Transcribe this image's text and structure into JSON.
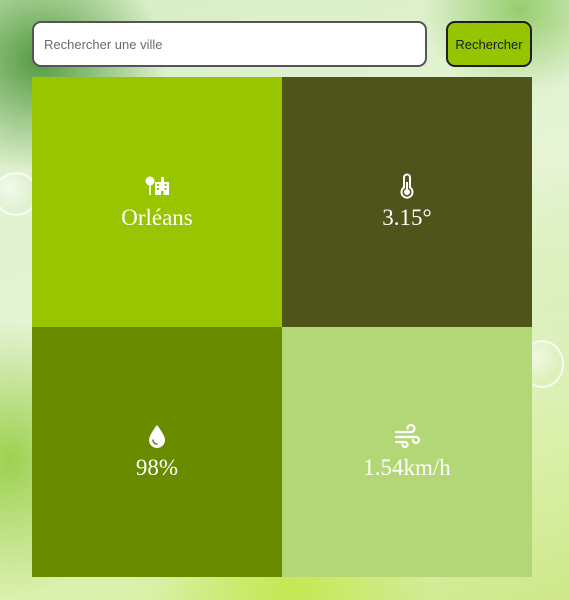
{
  "search": {
    "placeholder": "Rechercher une ville",
    "value": "",
    "button_label": "Rechercher"
  },
  "weather": {
    "city": {
      "icon": "city-icon",
      "value": "Orléans"
    },
    "temperature": {
      "icon": "thermometer-icon",
      "value": "3.15°"
    },
    "humidity": {
      "icon": "water-drop-icon",
      "value": "98%"
    },
    "wind": {
      "icon": "wind-icon",
      "value": "1.54km/h"
    }
  },
  "colors": {
    "accent": "#95c500",
    "tile_city": "#98c500",
    "tile_temperature": "#4e541a",
    "tile_humidity": "#698b00",
    "tile_wind": "#b3d776"
  }
}
